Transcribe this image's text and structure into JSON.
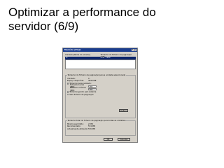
{
  "slide": {
    "title_line1": "Optimizar a performance do",
    "title_line2": "servidor (6/9)"
  },
  "dialog": {
    "title": "Memória virtual",
    "help_label": "?",
    "close_label": "×",
    "drive_table": {
      "col1": "Unidade  [Nome do volume]",
      "col2": "Tamanho do ficheiro de paginação (MB)",
      "row": {
        "drive": "C:",
        "size": "576 - 1152"
      }
    },
    "selected_group": {
      "legend": "Tamanho do ficheiro de paginação para a unidade seleccionada",
      "drive_label": "Unidade:",
      "drive_value": "C:",
      "space_label": "Espaço disponível:",
      "space_value": "3840 MB",
      "custom_label": "Tamanho personalizado:",
      "initial_label": "Tamanho inicial (MB):",
      "initial_value": "384",
      "max_label": "Tamanho máximo (MB):",
      "max_value": "384",
      "system_label": "Tamanho gerido pelo sistema",
      "none_label": "Sem ficheiro de paginação",
      "set_label": "Definir"
    },
    "total_group": {
      "legend": "Tamanho total do ficheiro de paginação para todas as unidades",
      "min_label": "Mínimo permitido:",
      "min_value": "2 MB",
      "rec_label": "Recomendado:",
      "rec_value": "574 MB",
      "cur_label": "Actualmente atribuído:",
      "cur_value": "576 MB"
    },
    "ok_label": "OK",
    "cancel_label": "Cancelar"
  }
}
